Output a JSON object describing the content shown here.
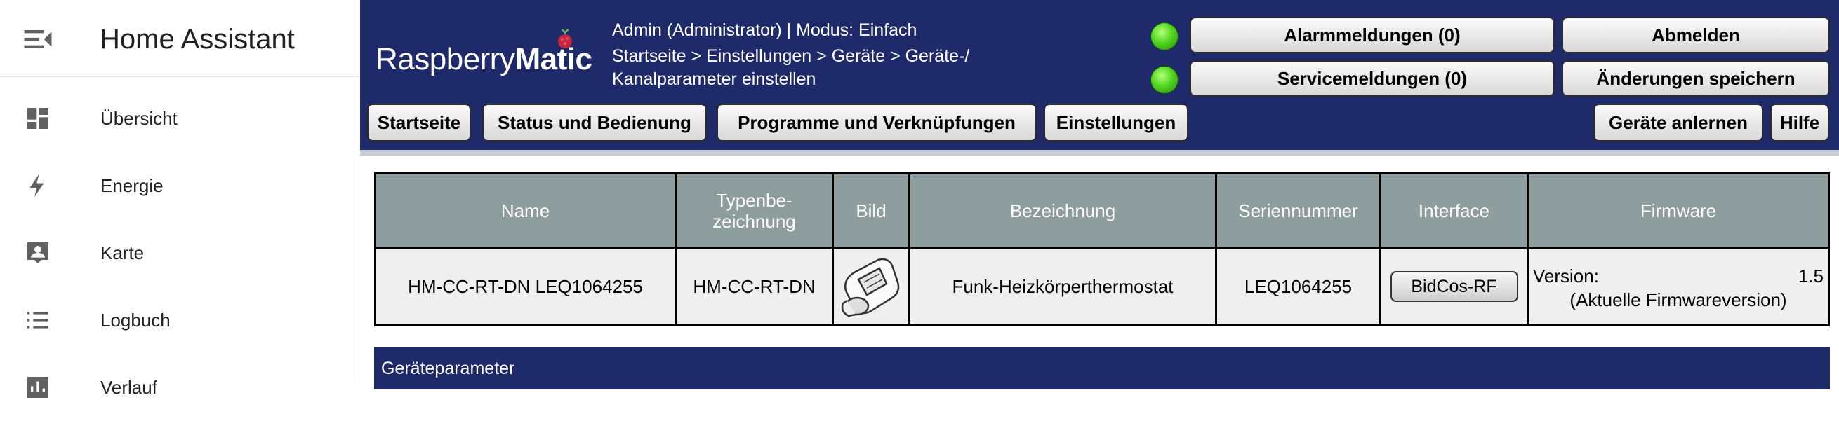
{
  "sidebar": {
    "title": "Home Assistant",
    "items": [
      {
        "label": "Übersicht",
        "icon": "dashboard-icon"
      },
      {
        "label": "Energie",
        "icon": "lightning-bolt-icon"
      },
      {
        "label": "Karte",
        "icon": "map-account-icon"
      },
      {
        "label": "Logbuch",
        "icon": "format-list-bulleted-icon"
      },
      {
        "label": "Verlauf",
        "icon": "chart-box-icon"
      }
    ]
  },
  "ccu": {
    "brand": {
      "name": "Raspberry",
      "bold": "Matic"
    },
    "user_info": "Admin (Administrator) | Modus: Einfach",
    "breadcrumb": "Startseite > Einstellungen > Geräte > Geräte-/ Kanalparameter einstellen",
    "buttons": {
      "alarm": "Alarmmeldungen (0)",
      "logout": "Abmelden",
      "service": "Servicemeldungen (0)",
      "save": "Änderungen speichern",
      "learn": "Geräte anlernen",
      "help": "Hilfe"
    },
    "nav": [
      "Startseite",
      "Status und Bedienung",
      "Programme und Verknüpfungen",
      "Einstellungen"
    ],
    "status_led_color": "#52d61f",
    "header_color": "#1f2a6b",
    "table": {
      "headers": {
        "name": "Name",
        "type": "Typenbe- zeichnung",
        "image": "Bild",
        "label": "Bezeichnung",
        "serial": "Seriennummer",
        "interface": "Interface",
        "firmware": "Firmware"
      },
      "row": {
        "name": "HM-CC-RT-DN LEQ1064255",
        "type": "HM-CC-RT-DN",
        "image_icon": "radiator-thermostat-icon",
        "label": "Funk-Heizkörperthermostat",
        "serial": "LEQ1064255",
        "interface": "BidCos-RF",
        "firmware_label": "Version:",
        "firmware_version": "1.5",
        "firmware_note": "(Aktuelle Firmwareversion)"
      }
    },
    "section_title": "Geräteparameter"
  }
}
